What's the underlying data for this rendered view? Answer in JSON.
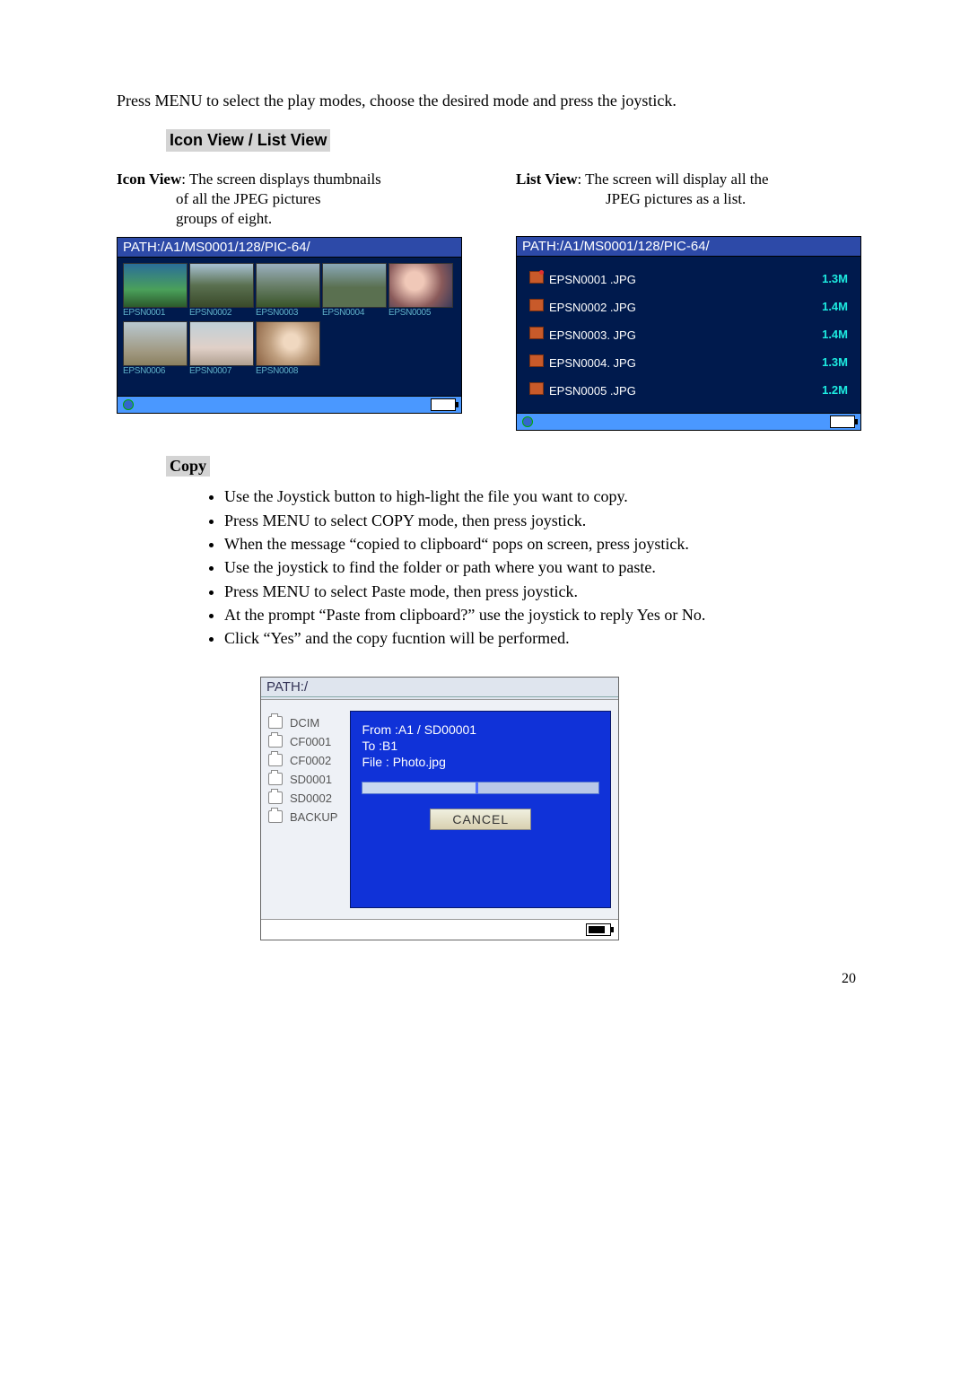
{
  "intro": "Press MENU to select the play modes, choose the desired mode and press the joystick.",
  "section_icon_list": "Icon View / List View",
  "icon_view_desc": {
    "label": "Icon View",
    "text1": ": The screen displays thumbnails",
    "text2": "of all the JPEG pictures",
    "text3": "groups of eight."
  },
  "list_view_desc": {
    "label": "List View",
    "text1": ": The screen will display all the",
    "text2": "JPEG pictures as a list."
  },
  "path_string": "PATH:/A1/MS0001/128/PIC-64/",
  "thumbs": [
    {
      "label": "EPSN0001"
    },
    {
      "label": "EPSN0002"
    },
    {
      "label": "EPSN0003"
    },
    {
      "label": "EPSN0004"
    },
    {
      "label": "EPSN0005"
    },
    {
      "label": "EPSN0006"
    },
    {
      "label": "EPSN0007"
    },
    {
      "label": "EPSN0008"
    }
  ],
  "list_rows": [
    {
      "name": "EPSN0001 .JPG",
      "size": "1.3M",
      "hl": true
    },
    {
      "name": "EPSN0002 .JPG",
      "size": "1.4M"
    },
    {
      "name": "EPSN0003. JPG",
      "size": "1.4M"
    },
    {
      "name": "EPSN0004. JPG",
      "size": "1.3M"
    },
    {
      "name": "EPSN0005 .JPG",
      "size": "1.2M"
    }
  ],
  "section_copy": "Copy",
  "copy_steps": [
    "Use the Joystick button to high-light the file you want to copy.",
    "Press MENU to select COPY mode, then press joystick.",
    "When the message “copied to clipboard“ pops on screen, press joystick.",
    "Use the joystick to find the folder or path where you want to paste.",
    "Press MENU to select Paste mode, then press joystick.",
    "At the prompt “Paste from clipboard?” use the joystick to reply Yes or No.",
    "Click “Yes” and the copy fucntion will be performed."
  ],
  "copy_shot": {
    "path": "PATH:/",
    "folders": [
      "DCIM",
      "CF0001",
      "CF0002",
      "SD0001",
      "SD0002",
      "BACKUP"
    ],
    "dialog": {
      "from": "From :A1 / SD00001",
      "to": "To     :B1",
      "file": "File   : Photo.jpg",
      "cancel": "CANCEL"
    }
  },
  "page_number": "20"
}
